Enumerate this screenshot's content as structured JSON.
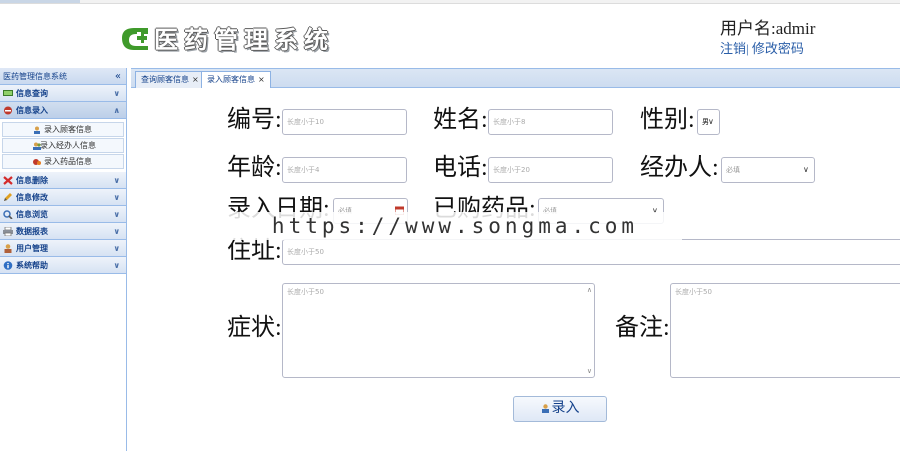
{
  "header": {
    "app_title": "医药管理系统",
    "user_label": "用户名:admir",
    "logout_label": "注销",
    "separator": "|",
    "change_password_label": "修改密码"
  },
  "sidebar": {
    "title": "医药管理信息系统",
    "collapse_glyph": "«",
    "sections": [
      {
        "label": "信息查询",
        "open": false
      },
      {
        "label": "信息录入",
        "open": true,
        "items": [
          "录入顾客信息",
          "录入经办人信息",
          "录入药品信息"
        ]
      },
      {
        "label": "信息删除",
        "open": false
      },
      {
        "label": "信息修改",
        "open": false
      },
      {
        "label": "信息浏览",
        "open": false
      },
      {
        "label": "数据报表",
        "open": false
      },
      {
        "label": "用户管理",
        "open": false
      },
      {
        "label": "系统帮助",
        "open": false
      }
    ]
  },
  "tabs": [
    {
      "label": "查询顾客信息",
      "active": false
    },
    {
      "label": "录入顾客信息",
      "active": true
    }
  ],
  "form": {
    "id_label": "编号:",
    "id_placeholder": "长度小于10",
    "name_label": "姓名:",
    "name_placeholder": "长度小于8",
    "gender_label": "性别:",
    "gender_value": "男",
    "age_label": "年龄:",
    "age_placeholder": "长度小于4",
    "phone_label": "电话:",
    "phone_placeholder": "长度小于20",
    "agent_label": "经办人:",
    "agent_placeholder": "必填",
    "date_label": "录入日期:",
    "date_placeholder": "必填",
    "drug_label": "已购药品:",
    "drug_placeholder": "必填",
    "address_label": "住址:",
    "address_placeholder": "长度小于50",
    "symptom_label": "症状:",
    "symptom_placeholder": "长度小于50",
    "remark_label": "备注:",
    "remark_placeholder": "长度小于50",
    "submit_label": "录入"
  },
  "watermark": "https://www.songma.com",
  "colors": {
    "panel_border": "#99bbe8",
    "header_text": "#15428b",
    "link": "#2a5ea8",
    "logo_green": "#3f9a2b"
  }
}
